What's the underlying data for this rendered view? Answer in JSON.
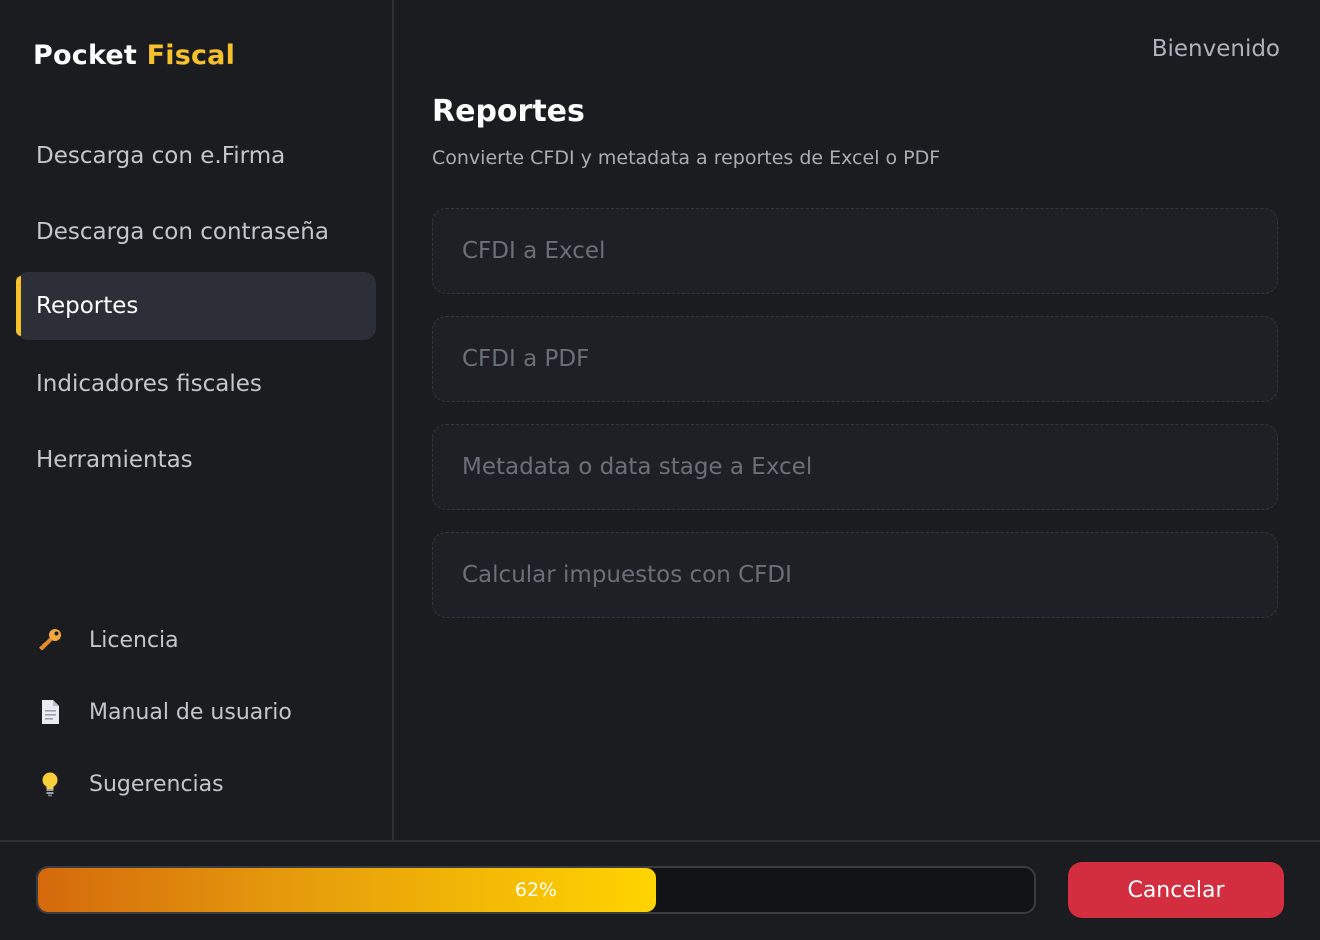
{
  "brand": {
    "name_part1": "Pocket",
    "name_part2": "Fiscal",
    "accent_color": "#f7c12b"
  },
  "sidebar": {
    "items": [
      {
        "label": "Descarga con e.Firma",
        "active": false
      },
      {
        "label": "Descarga con contraseña",
        "active": false
      },
      {
        "label": "Reportes",
        "active": true
      },
      {
        "label": "Indicadores fiscales",
        "active": false
      },
      {
        "label": "Herramientas",
        "active": false
      }
    ],
    "footer": [
      {
        "label": "Licencia",
        "icon": "key-icon"
      },
      {
        "label": "Manual de usuario",
        "icon": "document-icon"
      },
      {
        "label": "Sugerencias",
        "icon": "lightbulb-icon"
      }
    ]
  },
  "header": {
    "welcome": "Bienvenido"
  },
  "main": {
    "title": "Reportes",
    "subtitle": "Convierte CFDI y metadata a reportes de Excel o PDF",
    "options": [
      {
        "label": "CFDI a Excel"
      },
      {
        "label": "CFDI a PDF"
      },
      {
        "label": "Metadata o data stage a Excel"
      },
      {
        "label": "Calcular impuestos con CFDI"
      }
    ]
  },
  "progress": {
    "value": 0.62,
    "label": "62%"
  },
  "actions": {
    "cancel_label": "Cancelar",
    "cancel_color": "#d22e3f"
  }
}
